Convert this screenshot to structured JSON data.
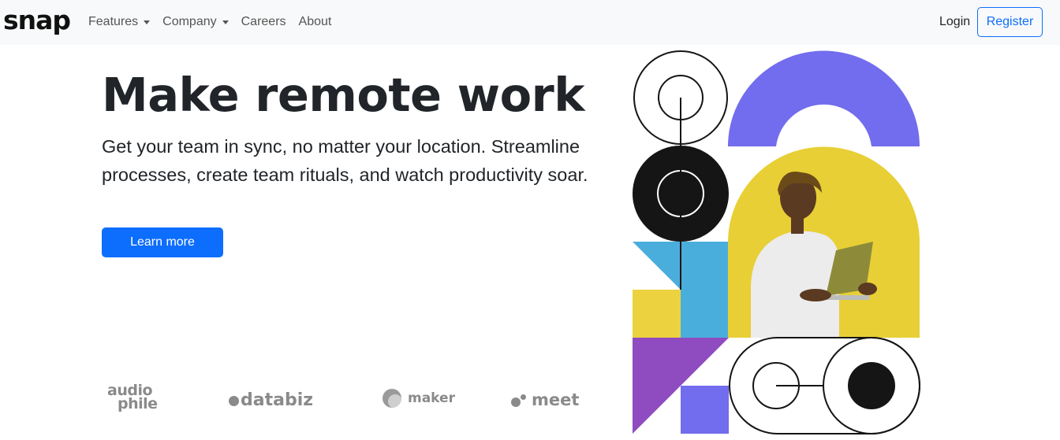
{
  "nav": {
    "brand": "snap",
    "links": [
      {
        "label": "Features",
        "dropdown": true
      },
      {
        "label": "Company",
        "dropdown": true
      },
      {
        "label": "Careers",
        "dropdown": false
      },
      {
        "label": "About",
        "dropdown": false
      }
    ],
    "login": "Login",
    "register": "Register"
  },
  "hero": {
    "title": "Make remote work",
    "text": "Get your team in sync, no matter your location. Streamline processes, create team rituals, and watch productivity soar.",
    "cta": "Learn more"
  },
  "clients": {
    "audiophile_top": "audio",
    "audiophile_bottom": "phile",
    "databiz": "databiz",
    "maker": "maker",
    "meet": "meet"
  },
  "colors": {
    "accent": "#0d6efd",
    "navbar_bg": "#f8f9fa",
    "purple": "#726cee",
    "yellow": "#ecd23f",
    "blue": "#4aaedc",
    "violet": "#8e4cc0",
    "dark": "#151515",
    "logo_gray": "#8a8a8a"
  }
}
